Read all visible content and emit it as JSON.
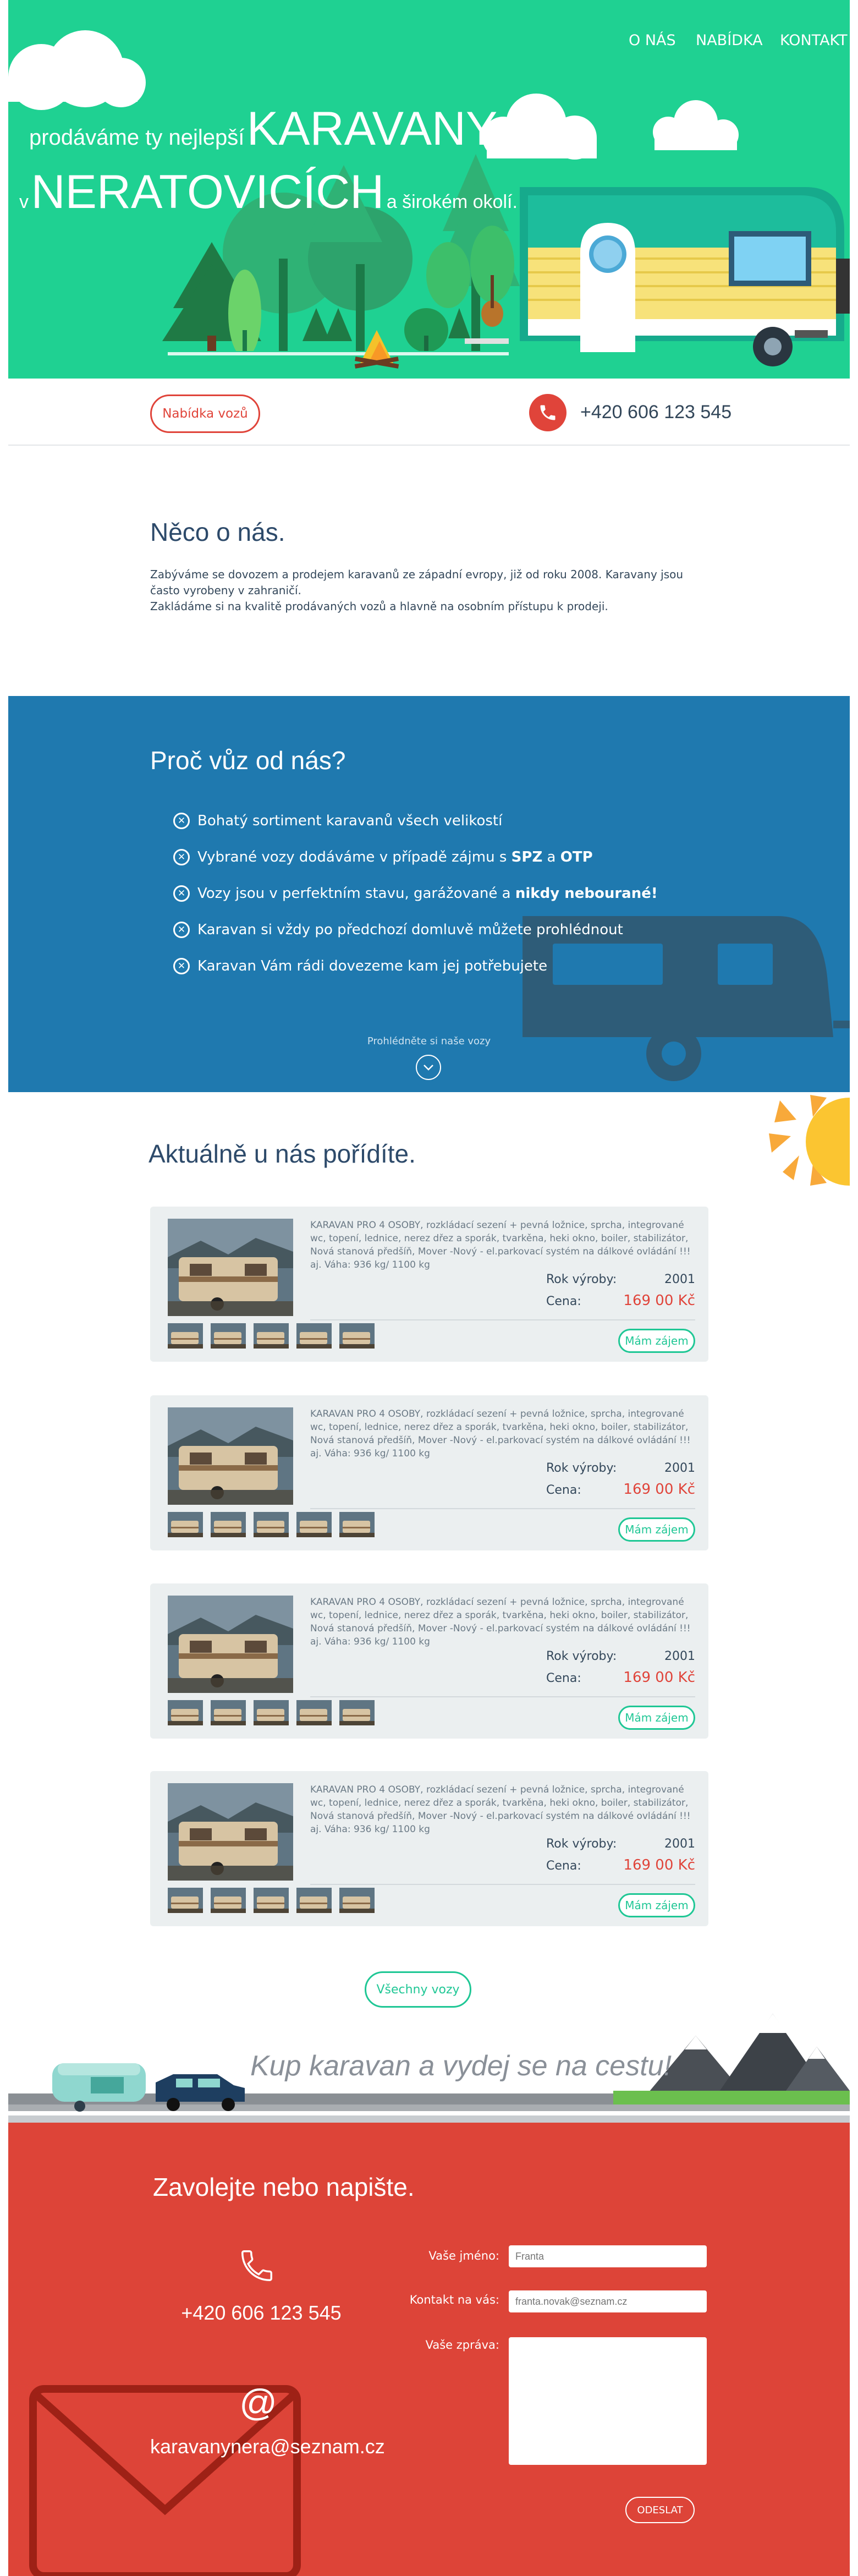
{
  "nav": {
    "items": [
      "O NÁS",
      "NABÍDKA",
      "KONTAKT"
    ]
  },
  "hero": {
    "line1_small": "prodáváme ty nejlepší",
    "line1_big": "KARAVANY",
    "line2_small": "v",
    "line2_big": "NERATOVICÍCH",
    "line2_tail": "a širokém okolí."
  },
  "contact_bar": {
    "offers_button": "Nabídka vozů",
    "phone": "+420 606 123 545"
  },
  "about": {
    "title": "Něco o nás.",
    "text1": "Zabýváme se dovozem a prodejem karavanů ze západní evropy, již od roku 2008. Karavany jsou často vyrobeny v zahraničí.",
    "text2": "Zakládáme si na kvalitě prodávaných vozů a hlavně na osobním přístupu k prodeji."
  },
  "why": {
    "title": "Proč vůz od nás?",
    "items": [
      {
        "text": "Bohatý sortiment karavanů všech velikostí"
      },
      {
        "text_pre": "Vybrané vozy dodáváme v případě zájmu s ",
        "bold1": "SPZ",
        "mid": " a ",
        "bold2": "OTP"
      },
      {
        "text_pre": "Vozy jsou v perfektním stavu, garážované a ",
        "bold1": "nikdy nebourané!"
      },
      {
        "text": "Karavan si vždy po předchozí domluvě můžete prohlédnout"
      },
      {
        "text": "Karavan Vám rádi dovezeme kam jej potřebujete"
      }
    ],
    "browse_label": "Prohlédněte si naše vozy"
  },
  "listings": {
    "title": "Aktuálně u nás pořídíte.",
    "year_label": "Rok výroby:",
    "price_label": "Cena:",
    "interest_button": "Mám zájem",
    "items": [
      {
        "desc": "KARAVAN PRO 4 OSOBY, rozkládací sezení + pevná ložnice, sprcha, integrované wc, topení, lednice, nerez dřez a sporák, tvarkěna, heki okno, boiler, stabilizátor, Nová stanová předšíň, Mover -Nový - el.parkovací systém na dálkové ovládání !!! aj. Váha: 936 kg/ 1100 kg",
        "year": "2001",
        "price": "169 00 Kč"
      },
      {
        "desc": "KARAVAN PRO 4 OSOBY, rozkládací sezení + pevná ložnice, sprcha, integrované wc, topení, lednice, nerez dřez a sporák, tvarkěna, heki okno, boiler, stabilizátor, Nová stanová předšíň, Mover -Nový - el.parkovací systém na dálkové ovládání !!! aj. Váha: 936 kg/ 1100 kg",
        "year": "2001",
        "price": "169 00 Kč"
      },
      {
        "desc": "KARAVAN PRO 4 OSOBY, rozkládací sezení + pevná ložnice, sprcha, integrované wc, topení, lednice, nerez dřez a sporák, tvarkěna, heki okno, boiler, stabilizátor, Nová stanová předšíň, Mover -Nový - el.parkovací systém na dálkové ovládání !!! aj. Váha: 936 kg/ 1100 kg",
        "year": "2001",
        "price": "169 00 Kč"
      },
      {
        "desc": "KARAVAN PRO 4 OSOBY, rozkládací sezení + pevná ložnice, sprcha, integrované wc, topení, lednice, nerez dřez a sporák, tvarkěna, heki okno, boiler, stabilizátor, Nová stanová předšíň, Mover -Nový - el.parkovací systém na dálkové ovládání !!! aj. Váha: 936 kg/ 1100 kg",
        "year": "2001",
        "price": "169 00 Kč"
      }
    ],
    "all_button": "Všechny vozy"
  },
  "banner": {
    "slogan": "Kup karavan a vydej se na cestu!"
  },
  "contact": {
    "title": "Zavolejte nebo napište.",
    "phone": "+420 606 123 545",
    "email": "karavanynera@seznam.cz",
    "name_label": "Vaše jméno:",
    "name_placeholder": "Franta",
    "email_label": "Kontakt na vás:",
    "email_placeholder": "franta.novak@seznam.cz",
    "message_label": "Vaše zpráva:",
    "send_button": "ODESLAT"
  },
  "colors": {
    "hero_green": "#1fd192",
    "blue": "#1f79af",
    "red": "#dd4438",
    "accent_green": "#1fc795"
  },
  "icons": [
    "phone-icon",
    "x-circle-icon",
    "chevron-down-icon",
    "sun-icon",
    "at-icon",
    "envelope-icon"
  ]
}
